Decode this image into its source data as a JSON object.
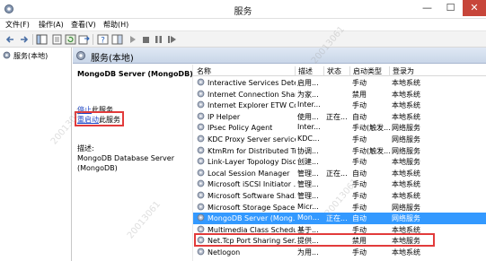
{
  "window": {
    "title": "服务",
    "minimize": "—",
    "maximize": "☐",
    "close": "✕"
  },
  "menu": [
    "文件(F)",
    "操作(A)",
    "查看(V)",
    "帮助(H)"
  ],
  "toolbar": {
    "icons": [
      "back-arrow-icon",
      "forward-arrow-icon",
      "console-tree-icon",
      "properties-icon",
      "refresh-icon",
      "export-list-icon",
      "help-icon",
      "show-hide-icon",
      "start-service-icon",
      "stop-service-icon",
      "pause-service-icon",
      "restart-service-icon"
    ]
  },
  "tree": {
    "item": "服务(本地)"
  },
  "panel": {
    "title": "服务(本地)"
  },
  "detail": {
    "service_name": "MongoDB Server (MongoDB)",
    "stop_link": "停止",
    "stop_suffix": "此服务",
    "restart_link": "重启动",
    "restart_suffix": "此服务",
    "desc_label": "描述:",
    "desc_text": "MongoDB Database Server (MongoDB)"
  },
  "list": {
    "columns": [
      "名称",
      "描述",
      "状态",
      "启动类型",
      "登录为"
    ],
    "rows": [
      {
        "name": "Interactive Services Dete...",
        "desc": "启用...",
        "status": "",
        "start": "手动",
        "logon": "本地系统"
      },
      {
        "name": "Internet Connection Shari...",
        "desc": "为家...",
        "status": "",
        "start": "禁用",
        "logon": "本地系统"
      },
      {
        "name": "Internet Explorer ETW Co...",
        "desc": "Inter...",
        "status": "",
        "start": "手动",
        "logon": "本地系统"
      },
      {
        "name": "IP Helper",
        "desc": "使用...",
        "status": "正在...",
        "start": "自动",
        "logon": "本地系统"
      },
      {
        "name": "IPsec Policy Agent",
        "desc": "Inter...",
        "status": "",
        "start": "手动(触发...",
        "logon": "网络服务"
      },
      {
        "name": "KDC Proxy Server service...",
        "desc": "KDC...",
        "status": "",
        "start": "手动",
        "logon": "网络服务"
      },
      {
        "name": "KtmRm for Distributed Tr...",
        "desc": "协调...",
        "status": "",
        "start": "手动(触发...",
        "logon": "网络服务"
      },
      {
        "name": "Link-Layer Topology Disc...",
        "desc": "创建...",
        "status": "",
        "start": "手动",
        "logon": "本地服务"
      },
      {
        "name": "Local Session Manager",
        "desc": "管理...",
        "status": "正在...",
        "start": "自动",
        "logon": "本地系统"
      },
      {
        "name": "Microsoft iSCSI Initiator ...",
        "desc": "管理...",
        "status": "",
        "start": "手动",
        "logon": "本地系统"
      },
      {
        "name": "Microsoft Software Shad...",
        "desc": "管理...",
        "status": "",
        "start": "手动",
        "logon": "本地系统"
      },
      {
        "name": "Microsoft Storage Space...",
        "desc": "Micr...",
        "status": "",
        "start": "手动",
        "logon": "网络服务"
      },
      {
        "name": "MongoDB Server (Mong...",
        "desc": "Mon...",
        "status": "正在...",
        "start": "自动",
        "logon": "网络服务",
        "selected": true
      },
      {
        "name": "Multimedia Class Schedu...",
        "desc": "基于...",
        "status": "",
        "start": "手动",
        "logon": "本地系统"
      },
      {
        "name": "Net.Tcp Port Sharing Ser...",
        "desc": "提供...",
        "status": "",
        "start": "禁用",
        "logon": "本地服务"
      },
      {
        "name": "Netlogon",
        "desc": "为用...",
        "status": "",
        "start": "手动",
        "logon": "本地系统"
      }
    ]
  },
  "watermark": "20013061"
}
